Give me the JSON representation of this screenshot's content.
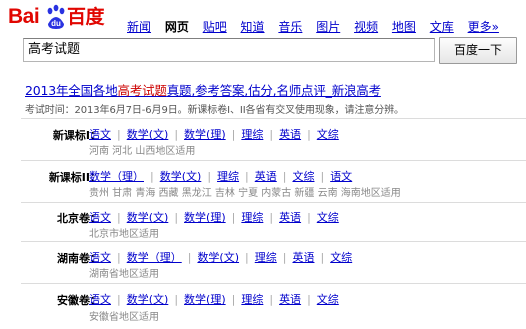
{
  "brand": {
    "bai": "Bai",
    "du": "du",
    "cn": "百度"
  },
  "nav": [
    "新闻",
    "网页",
    "贴吧",
    "知道",
    "音乐",
    "图片",
    "视频",
    "地图",
    "文库",
    "更多»"
  ],
  "nav_active": "网页",
  "search": {
    "value": "高考试题",
    "button": "百度一下"
  },
  "result": {
    "title_parts": [
      "2013年全国各地",
      "高考试题",
      "真题,参考答案,估分,名师点评_新浪高考"
    ],
    "desc": "考试时间：2013年6月7日-6月9日。新课标卷I、II各省有交叉使用现象，请注意分辨。"
  },
  "cards": [
    {
      "label": "新课标I：",
      "links": [
        "语文",
        "数学(文)",
        "数学(理)",
        "理综",
        "英语",
        "文综"
      ],
      "region": "河南 河北 山西地区适用"
    },
    {
      "label": "新课标II：",
      "links": [
        "数学（理）",
        "数学(文)",
        "理综",
        "英语",
        "文综",
        "语文"
      ],
      "region": "贵州 甘肃 青海 西藏 黑龙江 吉林 宁夏 内蒙古 新疆 云南 海南地区适用"
    },
    {
      "label": "北京卷：",
      "links": [
        "语文",
        "数学(文)",
        "数学(理)",
        "理综",
        "英语",
        "文综"
      ],
      "region": "北京市地区适用"
    },
    {
      "label": "湖南卷：",
      "links": [
        "语文",
        "数学（理）",
        "数学(文)",
        "理综",
        "英语",
        "文综"
      ],
      "region": "湖南省地区适用"
    },
    {
      "label": "安徽卷：",
      "links": [
        "语文",
        "数学(文)",
        "数学(理)",
        "理综",
        "英语",
        "文综"
      ],
      "region": "安徽省地区适用"
    }
  ],
  "colors": {
    "link": "#0000cc",
    "highlight": "#cc0000",
    "brand_red": "#e10601",
    "brand_blue": "#2932e1"
  }
}
